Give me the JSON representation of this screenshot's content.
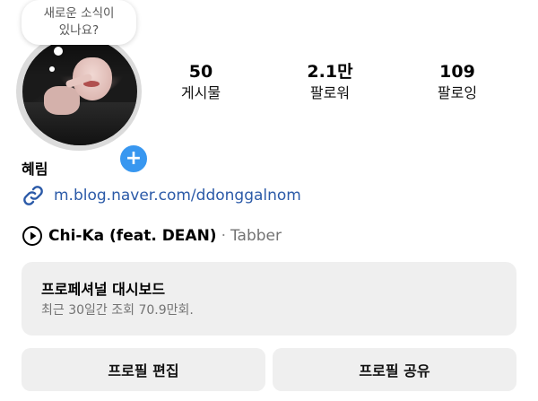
{
  "note": {
    "line1": "새로운 소식이",
    "line2": "있나요?"
  },
  "stats": [
    {
      "value": "50",
      "label": "게시물"
    },
    {
      "value": "2.1만",
      "label": "팔로워"
    },
    {
      "value": "109",
      "label": "팔로잉"
    }
  ],
  "profile": {
    "name": "혜림",
    "link": "m.blog.naver.com/ddonggalnom"
  },
  "music": {
    "song": "Chi-Ka (feat. DEAN)",
    "separator": "·",
    "artist": "Tabber"
  },
  "dashboard": {
    "title": "프로페셔널 대시보드",
    "subtitle": "최근 30일간 조회 70.9만회."
  },
  "buttons": {
    "edit_profile": "프로필 편집",
    "share_profile": "프로필 공유"
  },
  "add_story_symbol": "+",
  "colors": {
    "accent": "#3897f0",
    "link": "#2b5aa8",
    "button_bg": "#efefef"
  }
}
